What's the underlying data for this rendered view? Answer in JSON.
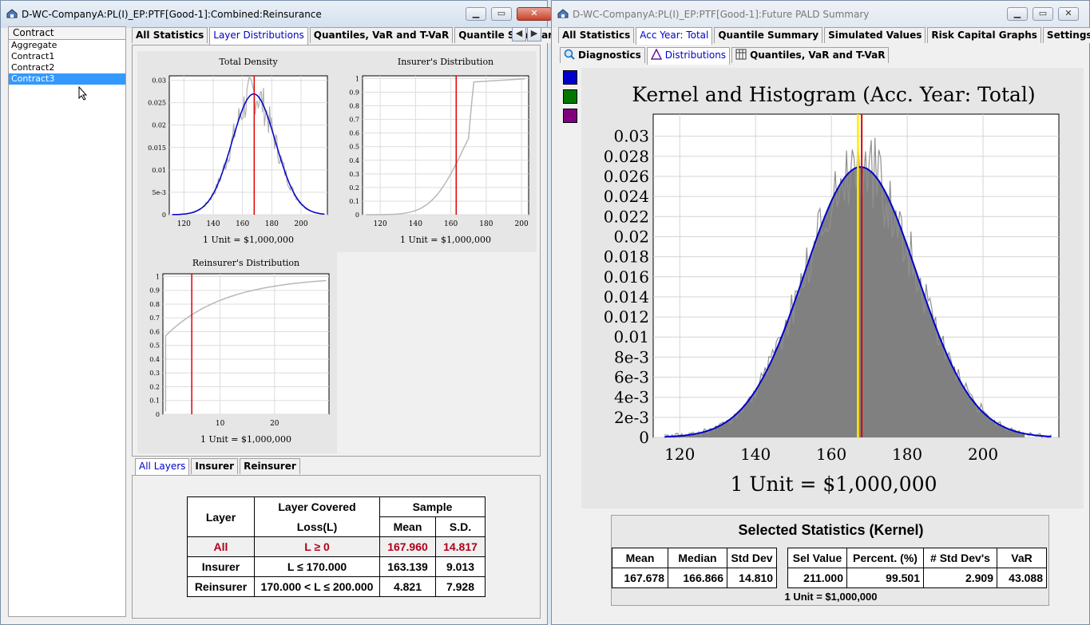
{
  "left_window": {
    "title": "D-WC-CompanyA:PL(I)_EP:PTF[Good-1]:Combined:Reinsurance",
    "list_header": "Contract",
    "list_items": [
      "Aggregate",
      "Contract1",
      "Contract2",
      "Contract3"
    ],
    "selected_item": "Contract3",
    "tabs": [
      "All Statistics",
      "Layer Distributions",
      "Quantiles, VaR and T-VaR",
      "Quantile Summary"
    ],
    "selected_tab": "Layer Distributions",
    "bottom_tabs": [
      "All Layers",
      "Insurer",
      "Reinsurer"
    ],
    "charts": {
      "total_density": {
        "title": "Total Density",
        "unit": "1 Unit = $1,000,000"
      },
      "insurer": {
        "title": "Insurer's Distribution",
        "unit": "1 Unit = $1,000,000"
      },
      "reinsurer": {
        "title": "Reinsurer's Distribution",
        "unit": "1 Unit = $1,000,000"
      }
    },
    "layer_table": {
      "h_layer": "Layer",
      "h_covered1": "Layer Covered",
      "h_covered2": "Loss(L)",
      "h_sample": "Sample",
      "h_mean": "Mean",
      "h_sd": "S.D.",
      "rows": [
        {
          "layer": "All",
          "covered": "L ≥ 0",
          "mean": "167.960",
          "sd": "14.817"
        },
        {
          "layer": "Insurer",
          "covered": "L ≤ 170.000",
          "mean": "163.139",
          "sd": "9.013"
        },
        {
          "layer": "Reinsurer",
          "covered": "170.000 < L ≤ 200.000",
          "mean": "4.821",
          "sd": "7.928"
        }
      ]
    }
  },
  "right_window": {
    "title": "D-WC-CompanyA:PL(I)_EP:PTF[Good-1]:Future PALD Summary",
    "tabs": [
      "All Statistics",
      "Acc Year: Total",
      "Quantile Summary",
      "Simulated Values",
      "Risk Capital Graphs",
      "Settings"
    ],
    "selected_tab": "Acc Year: Total",
    "subtabs": [
      "Diagnostics",
      "Distributions",
      "Quantiles, VaR and T-VaR"
    ],
    "selected_subtab": "Distributions",
    "swatches": [
      "#0000cc",
      "#007700",
      "#800080"
    ],
    "chart_title": "Kernel and Histogram (Acc. Year: Total)",
    "chart_unit": "1 Unit = $1,000,000",
    "stats_title": "Selected Statistics (Kernel)",
    "stats_headers": [
      "Mean",
      "Median",
      "Std Dev",
      "Sel Value",
      "Percent. (%)",
      "# Std Dev's",
      "VaR"
    ],
    "stats_values": [
      "167.678",
      "166.866",
      "14.810",
      "211.000",
      "99.501",
      "2.909",
      "43.088"
    ],
    "stats_unit": "1 Unit = $1,000,000"
  },
  "chart_data": [
    {
      "type": "line",
      "title": "Total Density",
      "xlabel": "1 Unit = $1,000,000",
      "x_ticks": [
        120,
        140,
        160,
        180,
        200
      ],
      "y_ticks": [
        "0",
        "5e-3",
        "0.01",
        "0.015",
        "0.02",
        "0.025",
        "0.03"
      ],
      "xlim": [
        110,
        218
      ],
      "ylim": [
        0,
        0.031
      ],
      "series": [
        {
          "kernel_mean": 167.7,
          "kernel_sd": 14.8,
          "color": "#0000cc"
        }
      ],
      "vline": 168
    },
    {
      "type": "line",
      "title": "Insurer's Distribution",
      "xlabel": "1 Unit = $1,000,000",
      "x_ticks": [
        120,
        140,
        160,
        180,
        200
      ],
      "y_ticks": [
        "0",
        "0.1",
        "0.2",
        "0.3",
        "0.4",
        "0.5",
        "0.6",
        "0.7",
        "0.8",
        "0.9",
        "1"
      ],
      "xlim": [
        110,
        204
      ],
      "ylim": [
        0,
        1.02
      ],
      "cap": 170,
      "vline": 163
    },
    {
      "type": "line",
      "title": "Reinsurer's Distribution",
      "xlabel": "1 Unit = $1,000,000",
      "x_ticks": [
        10,
        20
      ],
      "y_ticks": [
        "0",
        "0.1",
        "0.2",
        "0.3",
        "0.4",
        "0.5",
        "0.6",
        "0.7",
        "0.8",
        "0.9",
        "1"
      ],
      "xlim": [
        -0.5,
        30
      ],
      "ylim": [
        0,
        1.02
      ],
      "vline": 4.8
    },
    {
      "type": "area",
      "title": "Kernel and Histogram (Acc. Year: Total)",
      "xlabel": "1 Unit = $1,000,000",
      "x_ticks": [
        120,
        140,
        160,
        180,
        200
      ],
      "y_ticks": [
        "0",
        "2e-3",
        "4e-3",
        "6e-3",
        "8e-3",
        "0.01",
        "0.012",
        "0.014",
        "0.016",
        "0.018",
        "0.02",
        "0.022",
        "0.024",
        "0.026",
        "0.028",
        "0.03"
      ],
      "xlim": [
        113,
        220
      ],
      "ylim": [
        0,
        0.0322
      ],
      "kernel_mean": 167.7,
      "kernel_sd": 14.81,
      "yellow_line": 167.0,
      "red_line": 168.0
    }
  ]
}
